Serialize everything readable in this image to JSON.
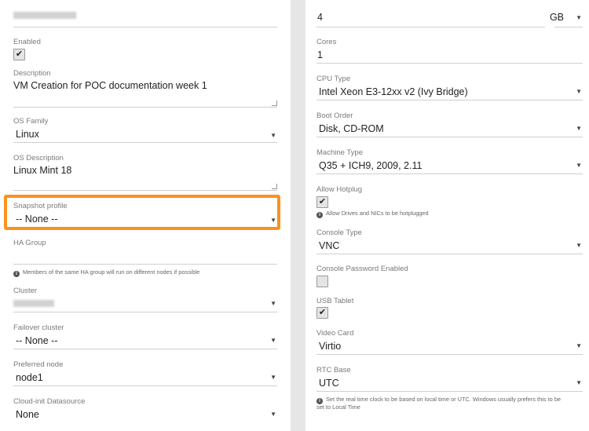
{
  "left": {
    "name_field": {
      "value_obscured": true
    },
    "enabled": {
      "label": "Enabled",
      "checked": true,
      "check_glyph": "✔"
    },
    "description": {
      "label": "Description",
      "value": "VM Creation for POC documentation week 1"
    },
    "os_family": {
      "label": "OS Family",
      "value": "Linux"
    },
    "os_description": {
      "label": "OS Description",
      "value": "Linux Mint 18"
    },
    "snapshot_profile": {
      "label": "Snapshot profile",
      "value": "-- None --",
      "highlighted": true
    },
    "ha_group": {
      "label": "HA Group",
      "value": "",
      "hint": "Members of the same HA group will run on different nodes if possible"
    },
    "cluster": {
      "label": "Cluster",
      "value_obscured": true
    },
    "failover_cluster": {
      "label": "Failover cluster",
      "value": "-- None --"
    },
    "preferred_node": {
      "label": "Preferred node",
      "value": "node1"
    },
    "cloud_init": {
      "label": "Cloud-init Datasource",
      "value": "None"
    }
  },
  "right": {
    "memory": {
      "value": "4",
      "unit": "GB"
    },
    "cores": {
      "label": "Cores",
      "value": "1"
    },
    "cpu_type": {
      "label": "CPU Type",
      "value": "Intel Xeon E3-12xx v2 (Ivy Bridge)"
    },
    "boot_order": {
      "label": "Boot Order",
      "value": "Disk, CD-ROM"
    },
    "machine_type": {
      "label": "Machine Type",
      "value": "Q35 + ICH9, 2009, 2.11"
    },
    "allow_hotplug": {
      "label": "Allow Hotplug",
      "checked": true,
      "check_glyph": "✔",
      "hint": "Allow Drives and NICs to be hotplugged"
    },
    "console_type": {
      "label": "Console Type",
      "value": "VNC"
    },
    "console_password": {
      "label": "Console Password Enabled",
      "checked": false
    },
    "usb_tablet": {
      "label": "USB Tablet",
      "checked": true,
      "check_glyph": "✔"
    },
    "video_card": {
      "label": "Video Card",
      "value": "Virtio"
    },
    "rtc_base": {
      "label": "RTC Base",
      "value": "UTC",
      "hint_line1": "Set the real time clock to be based on local time or UTC. Windows usually prefers this to be",
      "hint_line2": "set to Local Time"
    }
  },
  "glyphs": {
    "caret": "▼",
    "info": "i"
  },
  "colors": {
    "highlight": "#f7931e",
    "gutter": "#e6e6e6"
  }
}
